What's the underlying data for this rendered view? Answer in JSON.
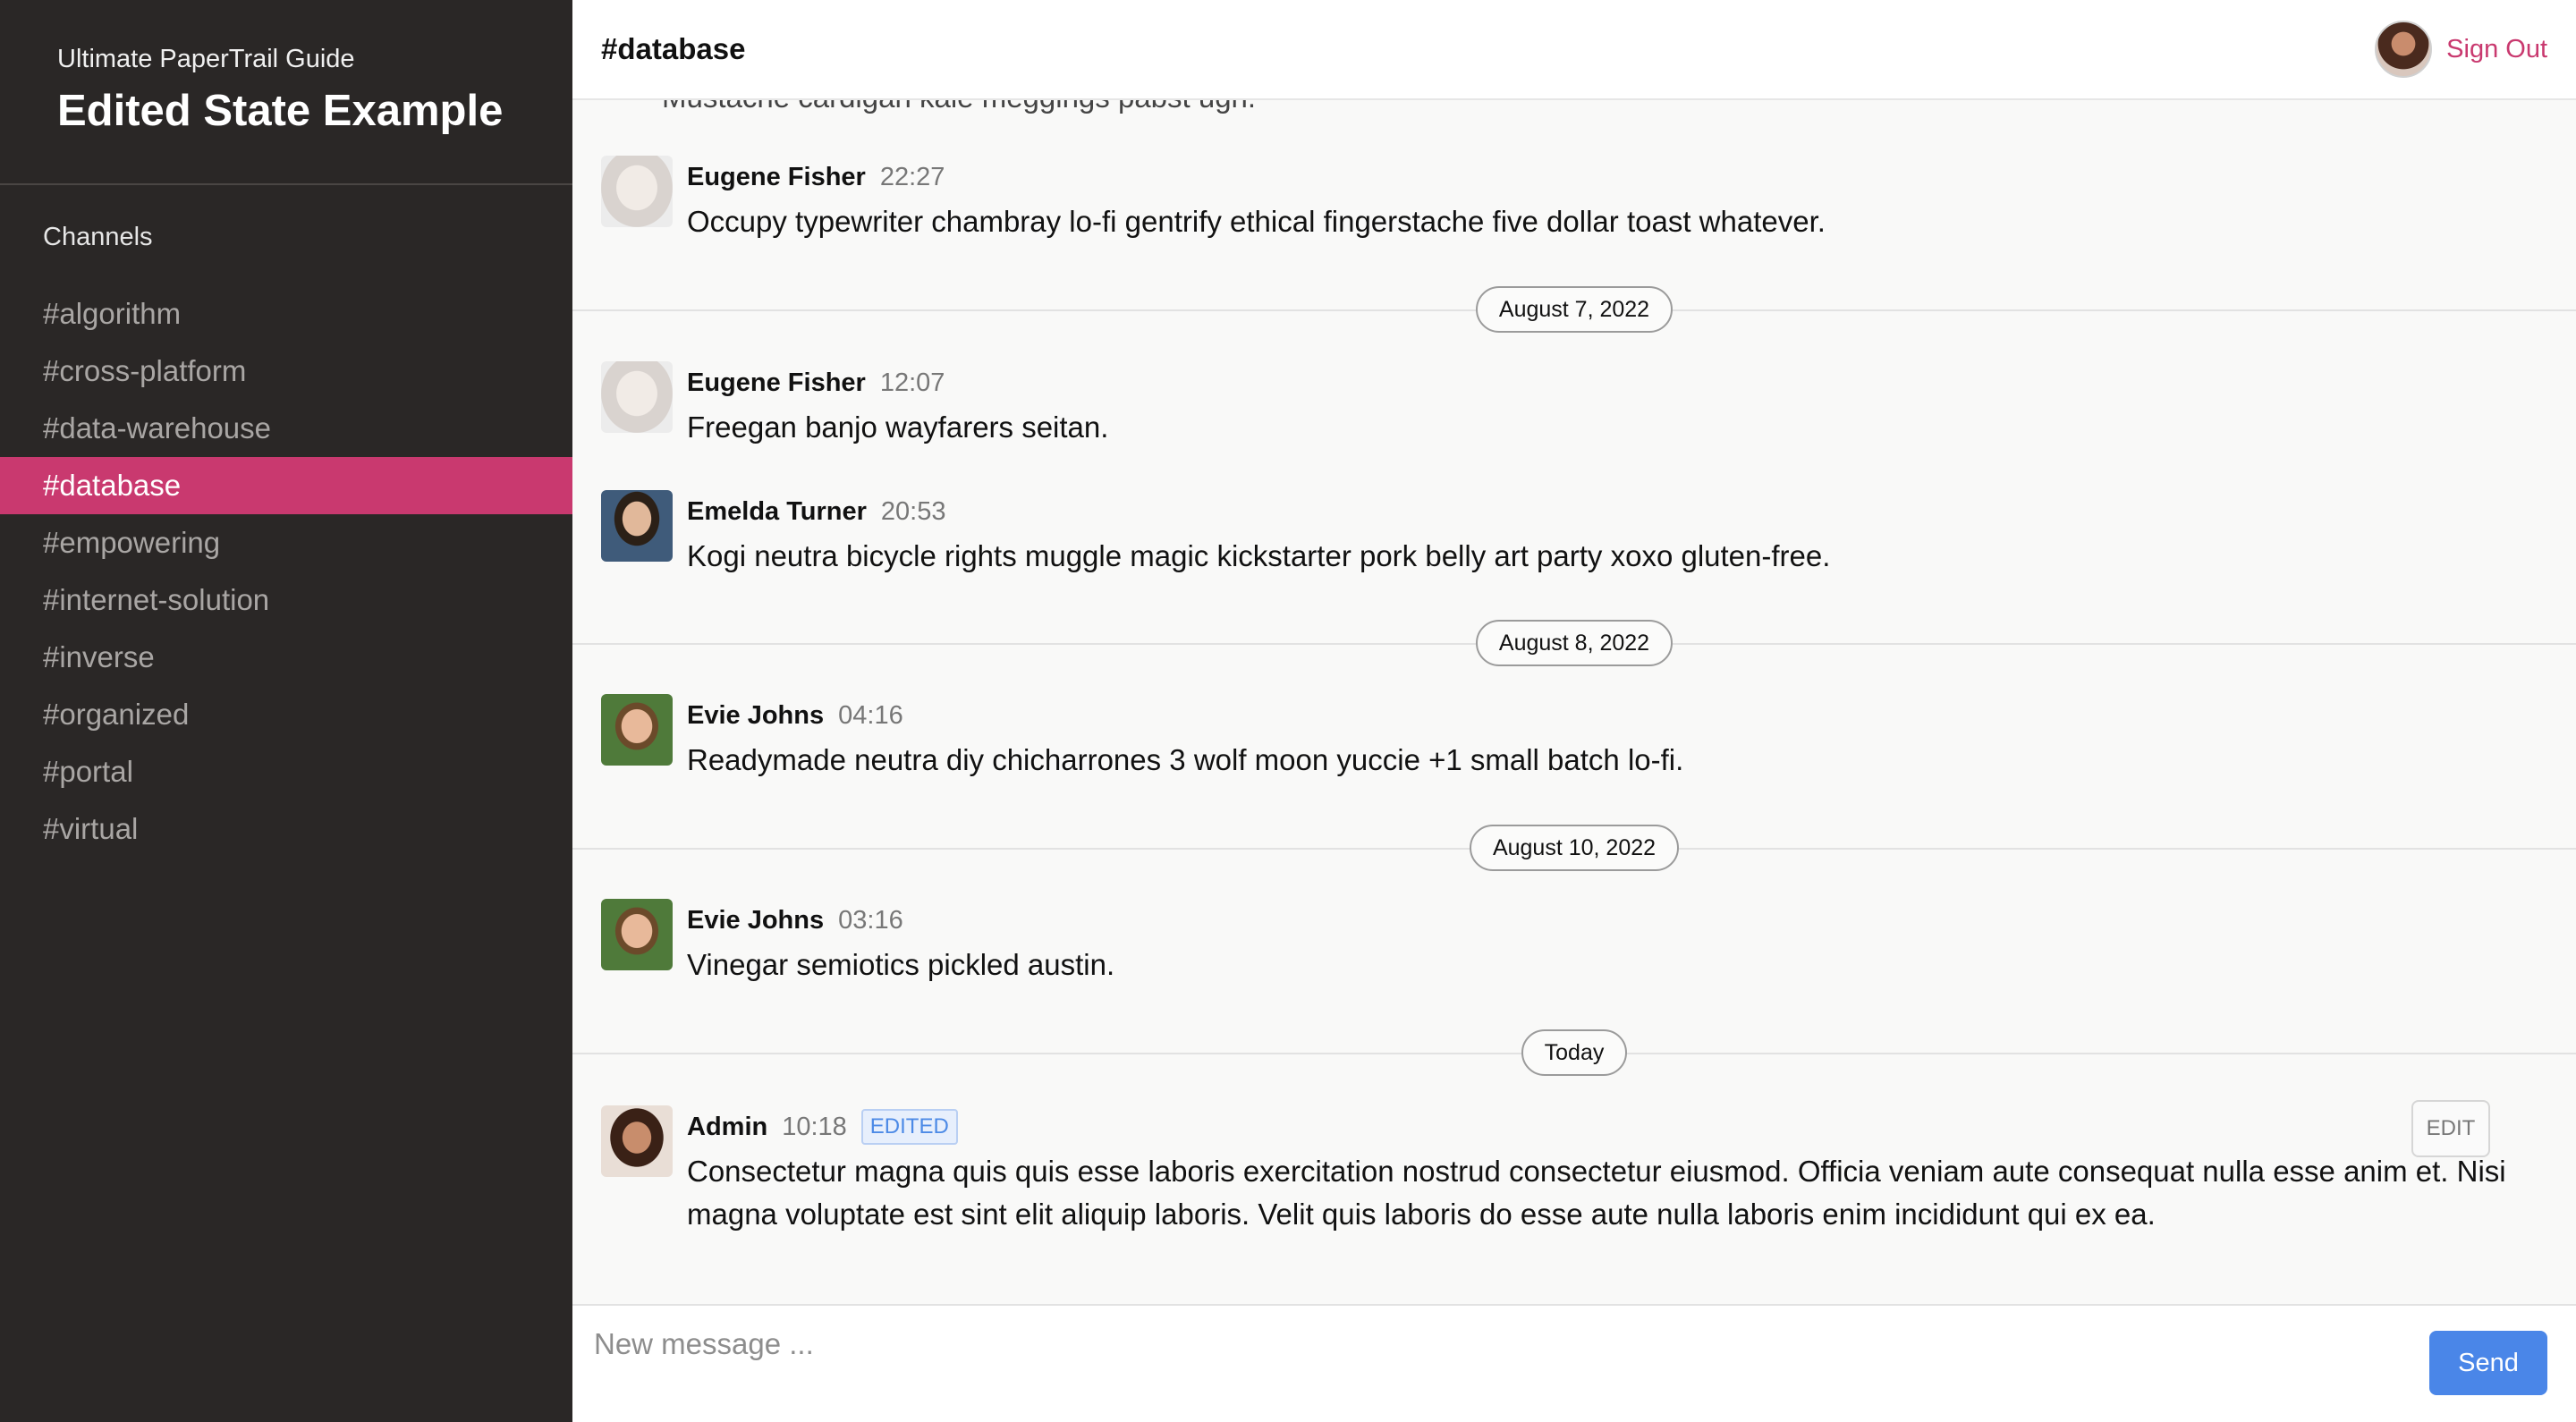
{
  "sidebar": {
    "subtitle": "Ultimate PaperTrail Guide",
    "title": "Edited State Example",
    "section_label": "Channels",
    "channels": [
      {
        "label": "#algorithm"
      },
      {
        "label": "#cross-platform"
      },
      {
        "label": "#data-warehouse"
      },
      {
        "label": "#database",
        "active": true
      },
      {
        "label": "#empowering"
      },
      {
        "label": "#internet-solution"
      },
      {
        "label": "#inverse"
      },
      {
        "label": "#organized"
      },
      {
        "label": "#portal"
      },
      {
        "label": "#virtual"
      }
    ]
  },
  "header": {
    "channel_title": "#database",
    "sign_out_label": "Sign Out"
  },
  "messages": {
    "partial_text": "Mustache cardigan kale meggings pabst ugh.",
    "items": [
      {
        "author": "Eugene Fisher",
        "time": "22:27",
        "text": "Occupy typewriter chambray lo-fi gentrify ethical fingerstache five dollar toast whatever."
      },
      {
        "author": "Eugene Fisher",
        "time": "12:07",
        "text": "Freegan banjo wayfarers seitan."
      },
      {
        "author": "Emelda Turner",
        "time": "20:53",
        "text": "Kogi neutra bicycle rights muggle magic kickstarter pork belly art party xoxo gluten-free."
      },
      {
        "author": "Evie Johns",
        "time": "04:16",
        "text": "Readymade neutra diy chicharrones 3 wolf moon yuccie +1 small batch lo-fi."
      },
      {
        "author": "Evie Johns",
        "time": "03:16",
        "text": "Vinegar semiotics pickled austin."
      },
      {
        "author": "Admin",
        "time": "10:18",
        "badge": "EDITED",
        "text": "Consectetur magna quis quis esse laboris exercitation nostrud consectetur eiusmod. Officia veniam aute consequat nulla esse anim et. Nisi magna voluptate est sint elit aliquip laboris. Velit quis laboris do esse aute nulla laboris enim incididunt qui ex ea.",
        "edit_label": "EDIT"
      }
    ],
    "dividers": [
      "August 7, 2022",
      "August 8, 2022",
      "August 10, 2022",
      "Today"
    ]
  },
  "composer": {
    "placeholder": "New message ...",
    "send_label": "Send"
  },
  "colors": {
    "accent": "#c9396f",
    "sidebar_bg": "#2a2726",
    "send_button": "#4a86e8"
  }
}
